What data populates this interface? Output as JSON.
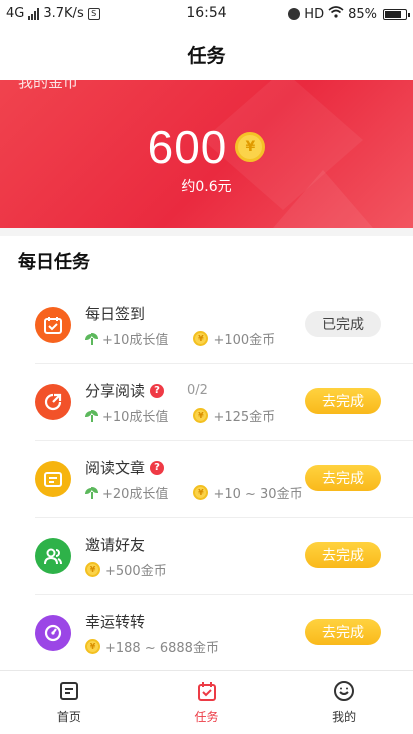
{
  "status_bar": {
    "network": "4G",
    "speed": "3.7K/s",
    "time": "16:54",
    "hd": "HD",
    "battery": "85%",
    "battery_level": 0.85
  },
  "header": {
    "title": "任务"
  },
  "banner": {
    "my_coins_label": "我的金币",
    "amount": "600",
    "coin_symbol": "¥",
    "approx": "约0.6元"
  },
  "section": {
    "title": "每日任务"
  },
  "tasks": [
    {
      "name": "每日签到",
      "icon": "calendar-check-icon",
      "icon_color": "#f7631e",
      "growth": "+10成长值",
      "coins": "+100金币",
      "button": "已完成",
      "status": "done"
    },
    {
      "name": "分享阅读",
      "icon": "share-icon",
      "icon_color": "#f25229",
      "progress": "0/2",
      "growth": "+10成长值",
      "coins": "+125金币",
      "button": "去完成",
      "status": "todo"
    },
    {
      "name": "阅读文章",
      "icon": "article-icon",
      "icon_color": "#f6b40f",
      "growth": "+20成长值",
      "coins": "+10 ~ 30金币",
      "button": "去完成",
      "status": "todo"
    },
    {
      "name": "邀请好友",
      "icon": "invite-friends-icon",
      "icon_color": "#2eb249",
      "coins": "+500金币",
      "button": "去完成",
      "status": "todo"
    },
    {
      "name": "幸运转转",
      "icon": "lucky-wheel-icon",
      "icon_color": "#9b46e6",
      "coins": "+188 ~ 6888金币",
      "button": "去完成",
      "status": "todo"
    }
  ],
  "bottom_nav": [
    {
      "label": "首页",
      "icon": "home-icon"
    },
    {
      "label": "任务",
      "icon": "tasks-icon",
      "active": true
    },
    {
      "label": "我的",
      "icon": "profile-icon"
    }
  ],
  "colors": {
    "banner_red": "#ea2a3f",
    "button_yellow": "#f9b91b",
    "active_nav": "#ec3b45"
  }
}
